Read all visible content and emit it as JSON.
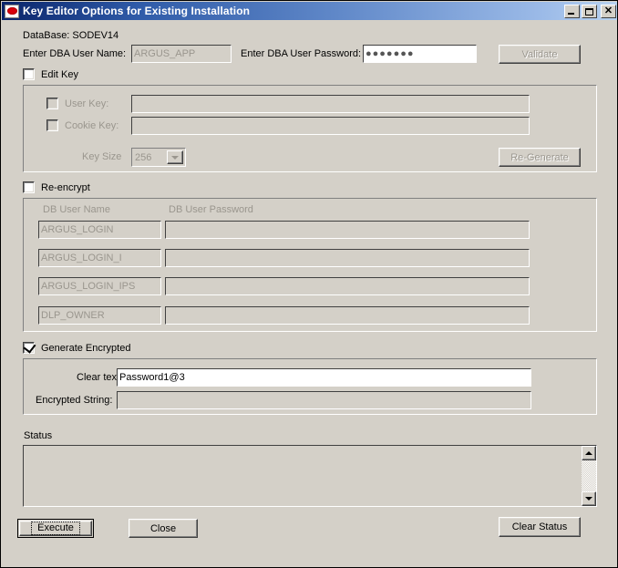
{
  "window": {
    "title": "Key Editor Options for Existing Installation",
    "icon": "oracle-oval-icon",
    "controls": {
      "minimize": "minimize-icon",
      "maximize": "maximize-icon",
      "close": "close-icon"
    }
  },
  "header": {
    "database_label": "DataBase: SODEV14",
    "dba_user_name_label": "Enter DBA User Name:",
    "dba_user_name_value": "ARGUS_APP",
    "dba_user_password_label": "Enter DBA User Password:",
    "dba_user_password_value": "●●●●●●●",
    "validate_label": "Validate",
    "validate_enabled": false
  },
  "edit_key": {
    "checkbox_label": "Edit Key",
    "checked": false,
    "user_key_label": "User Key:",
    "user_key_checked": false,
    "user_key_value": "",
    "cookie_key_label": "Cookie Key:",
    "cookie_key_checked": false,
    "cookie_key_value": "",
    "key_size_label": "Key Size",
    "key_size_value": "256",
    "key_size_options": [
      "256"
    ],
    "regenerate_label": "Re-Generate",
    "enabled": false
  },
  "re_encrypt": {
    "checkbox_label": "Re-encrypt",
    "checked": false,
    "enabled": false,
    "columns": [
      "DB User Name",
      "DB User Password"
    ],
    "rows": [
      {
        "user": "ARGUS_LOGIN",
        "password": ""
      },
      {
        "user": "ARGUS_LOGIN_I",
        "password": ""
      },
      {
        "user": "ARGUS_LOGIN_IPS",
        "password": ""
      },
      {
        "user": "DLP_OWNER",
        "password": ""
      }
    ]
  },
  "generate_encrypted": {
    "checkbox_label": "Generate Encrypted",
    "checked": true,
    "clear_text_label": "Clear text:",
    "clear_text_value": "Password1@3",
    "encrypted_string_label": "Encrypted String:",
    "encrypted_string_value": ""
  },
  "status": {
    "label": "Status",
    "text": "",
    "scroll_up": "scroll-up-icon",
    "scroll_down": "scroll-down-icon"
  },
  "footer": {
    "execute_label": "Execute",
    "close_label": "Close",
    "clear_status_label": "Clear Status"
  },
  "colors": {
    "dialog_background": "#d4d0c8",
    "titlebar_start": "#0a246a",
    "titlebar_end": "#b8d2f0",
    "disabled_text": "#9a968e",
    "icon_red": "#d8000c"
  }
}
